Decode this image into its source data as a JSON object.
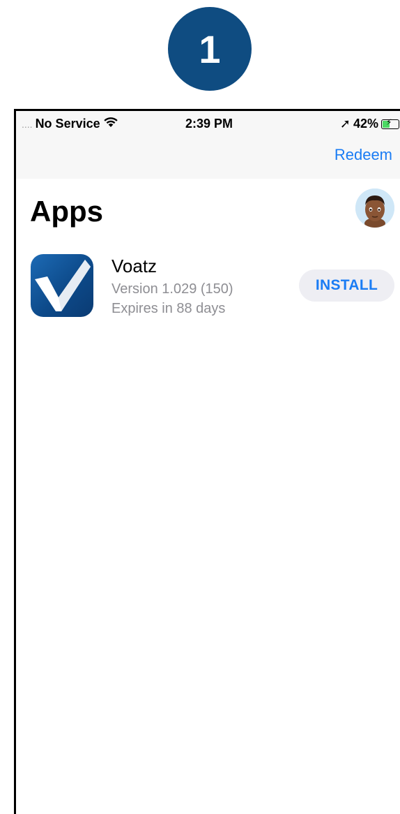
{
  "step_number": "1",
  "status_bar": {
    "signal_dots": "....",
    "carrier": "No Service",
    "time": "2:39 PM",
    "location_glyph": "➚",
    "battery_percent": "42%",
    "battery_level": 0.42
  },
  "nav": {
    "redeem_label": "Redeem"
  },
  "page": {
    "title": "Apps"
  },
  "apps": [
    {
      "name": "Voatz",
      "version": "Version 1.029 (150)",
      "expiry": "Expires in 88 days",
      "action_label": "INSTALL"
    }
  ],
  "colors": {
    "badge": "#0f4c81",
    "accent": "#1a7cf4",
    "nav_background": "#f7f7f7",
    "install_button_background": "#eeeef3",
    "secondary_text": "#8e8e93",
    "battery_fill": "#4cd964"
  },
  "icons": {
    "wifi": "wifi-icon",
    "location": "location-arrow-icon",
    "battery": "battery-charging-icon",
    "avatar": "memoji-avatar",
    "app": "voatz-checkmark-icon"
  }
}
